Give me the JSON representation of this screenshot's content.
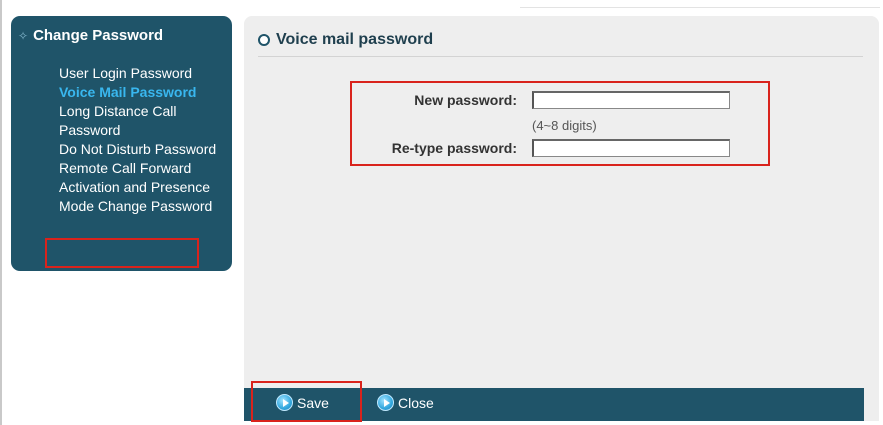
{
  "sidebar": {
    "header": "Change Password",
    "items": [
      {
        "label": "User Login Password"
      },
      {
        "label": "Voice Mail Password"
      },
      {
        "label": "Long Distance Call Password"
      },
      {
        "label": "Do Not Disturb Password"
      },
      {
        "label": "Remote Call Forward Activation and Presence Mode Change Password"
      }
    ],
    "active_index": 1
  },
  "main": {
    "title": "Voice mail password",
    "form": {
      "new_password_label": "New password:",
      "new_password_value": "",
      "hint": "(4~8 digits)",
      "retype_password_label": "Re-type password:",
      "retype_password_value": ""
    }
  },
  "toolbar": {
    "save_label": "Save",
    "close_label": "Close"
  },
  "colors": {
    "sidebar_bg": "#1f5469",
    "active_item": "#39b7ef",
    "highlight_frame": "#d9231c",
    "panel_bg": "#eeeeee"
  }
}
